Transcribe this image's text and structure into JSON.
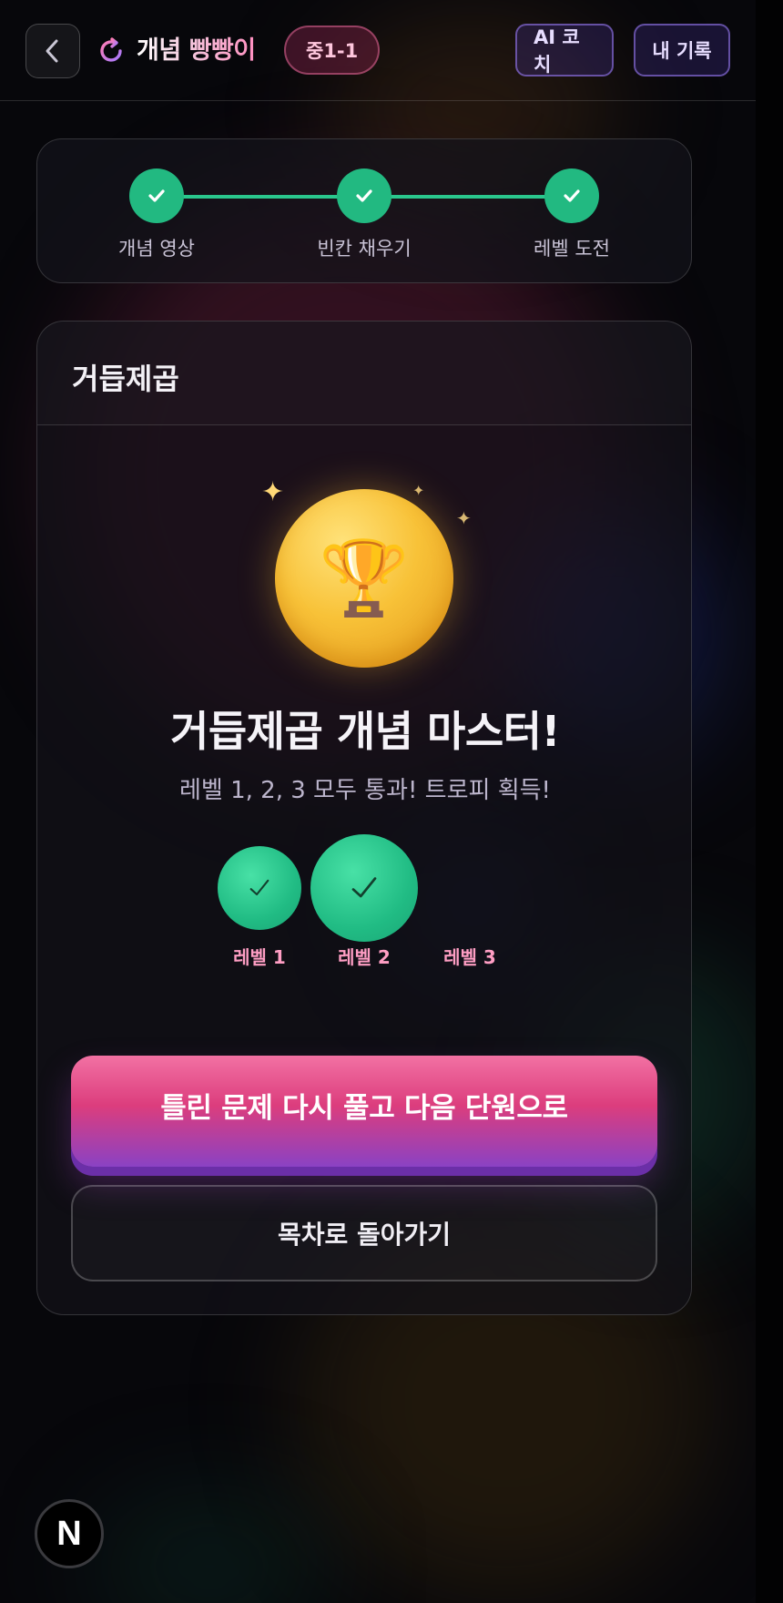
{
  "header": {
    "app_title": "개념 빵빵이",
    "unit_badge": "중1-1",
    "ai_coach_label": "AI 코치",
    "my_record_label": "내 기록"
  },
  "progress": {
    "steps": [
      {
        "label": "개념 영상",
        "status": "done"
      },
      {
        "label": "빈칸 채우기",
        "status": "done"
      },
      {
        "label": "레벨 도전",
        "status": "done"
      }
    ]
  },
  "card": {
    "title": "거듭제곱",
    "mastery_title": "거듭제곱 개념 마스터!",
    "mastery_subtitle": "레벨 1, 2, 3 모두 통과! 트로피 획득!",
    "trophy_emoji": "🏆",
    "levels": [
      {
        "label": "레벨 1",
        "passed": true
      },
      {
        "label": "레벨 2",
        "passed": true
      },
      {
        "label": "레벨 3",
        "passed": true
      }
    ],
    "primary_button": "틀린 문제 다시 풀고 다음 단원으로",
    "secondary_button": "목차로 돌아가기"
  },
  "dev_badge_letter": "N",
  "colors": {
    "accent_green": "#22b981",
    "accent_pink": "#dc3d7d",
    "accent_purple": "#8a42c4",
    "trophy_gold": "#f8c238"
  },
  "icons": [
    "back-arrow-icon",
    "refresh-icon",
    "check-icon",
    "trophy-icon",
    "sparkle-icon"
  ]
}
